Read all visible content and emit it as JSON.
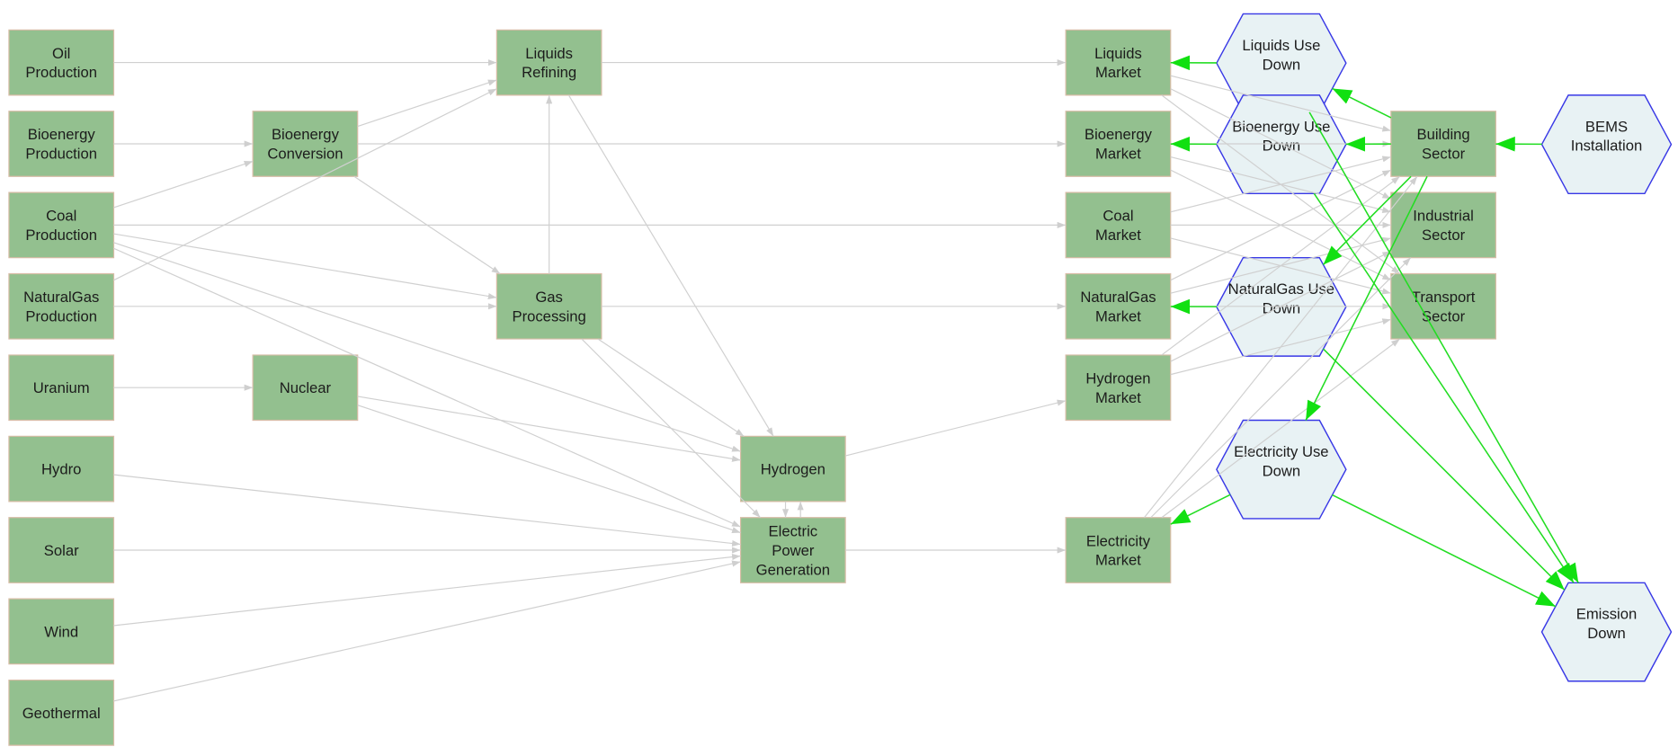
{
  "colors": {
    "box_fill": "#93c08f",
    "box_stroke": "#d8bca6",
    "hex_fill": "#e8f2f4",
    "hex_stroke": "#3838e6",
    "edge_gray": "#d0d0d0",
    "edge_green": "#22dd22",
    "text": "#1c1c1c"
  },
  "nodes": [
    {
      "id": "oil_prod",
      "shape": "box",
      "label": [
        "Oil",
        "Production"
      ]
    },
    {
      "id": "bio_prod",
      "shape": "box",
      "label": [
        "Bioenergy",
        "Production"
      ]
    },
    {
      "id": "coal_prod",
      "shape": "box",
      "label": [
        "Coal",
        "Production"
      ]
    },
    {
      "id": "ng_prod",
      "shape": "box",
      "label": [
        "NaturalGas",
        "Production"
      ]
    },
    {
      "id": "uranium",
      "shape": "box",
      "label": [
        "Uranium"
      ]
    },
    {
      "id": "hydro",
      "shape": "box",
      "label": [
        "Hydro"
      ]
    },
    {
      "id": "solar",
      "shape": "box",
      "label": [
        "Solar"
      ]
    },
    {
      "id": "wind",
      "shape": "box",
      "label": [
        "Wind"
      ]
    },
    {
      "id": "geothermal",
      "shape": "box",
      "label": [
        "Geothermal"
      ]
    },
    {
      "id": "bio_conv",
      "shape": "box",
      "label": [
        "Bioenergy",
        "Conversion"
      ]
    },
    {
      "id": "nuclear",
      "shape": "box",
      "label": [
        "Nuclear"
      ]
    },
    {
      "id": "liq_ref",
      "shape": "box",
      "label": [
        "Liquids",
        "Refining"
      ]
    },
    {
      "id": "gas_proc",
      "shape": "box",
      "label": [
        "Gas",
        "Processing"
      ]
    },
    {
      "id": "hydrogen",
      "shape": "box",
      "label": [
        "Hydrogen"
      ]
    },
    {
      "id": "elec_gen",
      "shape": "box",
      "label": [
        "Electric",
        "Power",
        "Generation"
      ]
    },
    {
      "id": "liq_market",
      "shape": "box",
      "label": [
        "Liquids",
        "Market"
      ]
    },
    {
      "id": "bio_market",
      "shape": "box",
      "label": [
        "Bioenergy",
        "Market"
      ]
    },
    {
      "id": "coal_market",
      "shape": "box",
      "label": [
        "Coal",
        "Market"
      ]
    },
    {
      "id": "ng_market",
      "shape": "box",
      "label": [
        "NaturalGas",
        "Market"
      ]
    },
    {
      "id": "h2_market",
      "shape": "box",
      "label": [
        "Hydrogen",
        "Market"
      ]
    },
    {
      "id": "elec_market",
      "shape": "box",
      "label": [
        "Electricity",
        "Market"
      ]
    },
    {
      "id": "liq_use",
      "shape": "hexagon",
      "label": [
        "Liquids Use",
        "Down"
      ]
    },
    {
      "id": "bio_use",
      "shape": "hexagon",
      "label": [
        "Bioenergy Use",
        "Down"
      ]
    },
    {
      "id": "ng_use",
      "shape": "hexagon",
      "label": [
        "NaturalGas Use",
        "Down"
      ]
    },
    {
      "id": "elec_use",
      "shape": "hexagon",
      "label": [
        "Electricity Use",
        "Down"
      ]
    },
    {
      "id": "building",
      "shape": "box",
      "label": [
        "Building",
        "Sector"
      ]
    },
    {
      "id": "industrial",
      "shape": "box",
      "label": [
        "Industrial",
        "Sector"
      ]
    },
    {
      "id": "transport",
      "shape": "box",
      "label": [
        "Transport",
        "Sector"
      ]
    },
    {
      "id": "bems",
      "shape": "hexagon",
      "label": [
        "BEMS",
        "Installation"
      ]
    },
    {
      "id": "emission",
      "shape": "hexagon",
      "label": [
        "Emission",
        "Down"
      ]
    }
  ],
  "edges": [
    {
      "from": "oil_prod",
      "to": "liq_ref",
      "type": "flow"
    },
    {
      "from": "bio_prod",
      "to": "bio_conv",
      "type": "flow"
    },
    {
      "from": "coal_prod",
      "to": "bio_conv",
      "type": "flow"
    },
    {
      "from": "ng_prod",
      "to": "liq_ref",
      "type": "flow"
    },
    {
      "from": "bio_conv",
      "to": "liq_ref",
      "type": "flow"
    },
    {
      "from": "bio_conv",
      "to": "bio_market",
      "type": "flow"
    },
    {
      "from": "bio_conv",
      "to": "gas_proc",
      "type": "flow"
    },
    {
      "from": "coal_prod",
      "to": "coal_market",
      "type": "flow"
    },
    {
      "from": "coal_prod",
      "to": "gas_proc",
      "type": "flow"
    },
    {
      "from": "coal_prod",
      "to": "hydrogen",
      "type": "flow"
    },
    {
      "from": "coal_prod",
      "to": "elec_gen",
      "type": "flow"
    },
    {
      "from": "ng_prod",
      "to": "gas_proc",
      "type": "flow"
    },
    {
      "from": "gas_proc",
      "to": "liq_ref",
      "type": "flow"
    },
    {
      "from": "gas_proc",
      "to": "ng_market",
      "type": "flow"
    },
    {
      "from": "gas_proc",
      "to": "hydrogen",
      "type": "flow"
    },
    {
      "from": "gas_proc",
      "to": "elec_gen",
      "type": "flow"
    },
    {
      "from": "liq_ref",
      "to": "liq_market",
      "type": "flow"
    },
    {
      "from": "liq_ref",
      "to": "hydrogen",
      "type": "flow"
    },
    {
      "from": "uranium",
      "to": "nuclear",
      "type": "flow"
    },
    {
      "from": "nuclear",
      "to": "hydrogen",
      "type": "flow"
    },
    {
      "from": "nuclear",
      "to": "elec_gen",
      "type": "flow"
    },
    {
      "from": "hydro",
      "to": "elec_gen",
      "type": "flow"
    },
    {
      "from": "solar",
      "to": "elec_gen",
      "type": "flow"
    },
    {
      "from": "wind",
      "to": "elec_gen",
      "type": "flow"
    },
    {
      "from": "geothermal",
      "to": "elec_gen",
      "type": "flow"
    },
    {
      "from": "elec_gen",
      "to": "hydrogen",
      "type": "flow"
    },
    {
      "from": "hydrogen",
      "to": "elec_gen",
      "type": "flow"
    },
    {
      "from": "hydrogen",
      "to": "h2_market",
      "type": "flow"
    },
    {
      "from": "elec_gen",
      "to": "elec_market",
      "type": "flow"
    },
    {
      "from": "liq_market",
      "to": "building",
      "type": "flow"
    },
    {
      "from": "liq_market",
      "to": "industrial",
      "type": "flow"
    },
    {
      "from": "liq_market",
      "to": "transport",
      "type": "flow"
    },
    {
      "from": "bio_market",
      "to": "building",
      "type": "flow"
    },
    {
      "from": "bio_market",
      "to": "industrial",
      "type": "flow"
    },
    {
      "from": "bio_market",
      "to": "transport",
      "type": "flow"
    },
    {
      "from": "coal_market",
      "to": "building",
      "type": "flow"
    },
    {
      "from": "coal_market",
      "to": "industrial",
      "type": "flow"
    },
    {
      "from": "coal_market",
      "to": "transport",
      "type": "flow"
    },
    {
      "from": "ng_market",
      "to": "building",
      "type": "flow"
    },
    {
      "from": "ng_market",
      "to": "industrial",
      "type": "flow"
    },
    {
      "from": "ng_market",
      "to": "transport",
      "type": "flow"
    },
    {
      "from": "h2_market",
      "to": "building",
      "type": "flow"
    },
    {
      "from": "h2_market",
      "to": "industrial",
      "type": "flow"
    },
    {
      "from": "h2_market",
      "to": "transport",
      "type": "flow"
    },
    {
      "from": "elec_market",
      "to": "building",
      "type": "flow"
    },
    {
      "from": "elec_market",
      "to": "industrial",
      "type": "flow"
    },
    {
      "from": "elec_market",
      "to": "transport",
      "type": "flow"
    },
    {
      "from": "liq_use",
      "to": "liq_market",
      "type": "effect"
    },
    {
      "from": "bio_use",
      "to": "bio_market",
      "type": "effect"
    },
    {
      "from": "ng_use",
      "to": "ng_market",
      "type": "effect"
    },
    {
      "from": "elec_use",
      "to": "elec_market",
      "type": "effect"
    },
    {
      "from": "building",
      "to": "liq_use",
      "type": "effect"
    },
    {
      "from": "building",
      "to": "bio_use",
      "type": "effect"
    },
    {
      "from": "building",
      "to": "ng_use",
      "type": "effect"
    },
    {
      "from": "building",
      "to": "elec_use",
      "type": "effect"
    },
    {
      "from": "bems",
      "to": "building",
      "type": "effect"
    },
    {
      "from": "liq_use",
      "to": "emission",
      "type": "effect"
    },
    {
      "from": "bio_use",
      "to": "emission",
      "type": "effect"
    },
    {
      "from": "ng_use",
      "to": "emission",
      "type": "effect"
    },
    {
      "from": "elec_use",
      "to": "emission",
      "type": "effect"
    }
  ]
}
